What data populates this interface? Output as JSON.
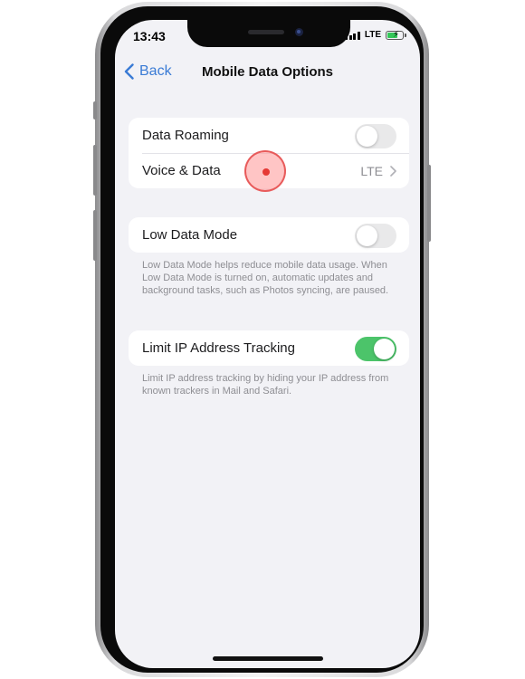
{
  "status": {
    "time": "13:43",
    "network": "LTE"
  },
  "nav": {
    "back_label": "Back",
    "title": "Mobile Data Options"
  },
  "group1": {
    "data_roaming": {
      "label": "Data Roaming",
      "enabled": false
    },
    "voice_data": {
      "label": "Voice & Data",
      "value": "LTE"
    }
  },
  "group2": {
    "low_data_mode": {
      "label": "Low Data Mode",
      "enabled": false
    },
    "footnote": "Low Data Mode helps reduce mobile data usage. When Low Data Mode is turned on, automatic updates and background tasks, such as Photos syncing, are paused."
  },
  "group3": {
    "limit_ip": {
      "label": "Limit IP Address Tracking",
      "enabled": true
    },
    "footnote": "Limit IP address tracking by hiding your IP address from known trackers in Mail and Safari."
  },
  "colors": {
    "accent": "#3a7bd5",
    "toggle_on": "#4cc46a",
    "tap_marker": "#e53935"
  }
}
